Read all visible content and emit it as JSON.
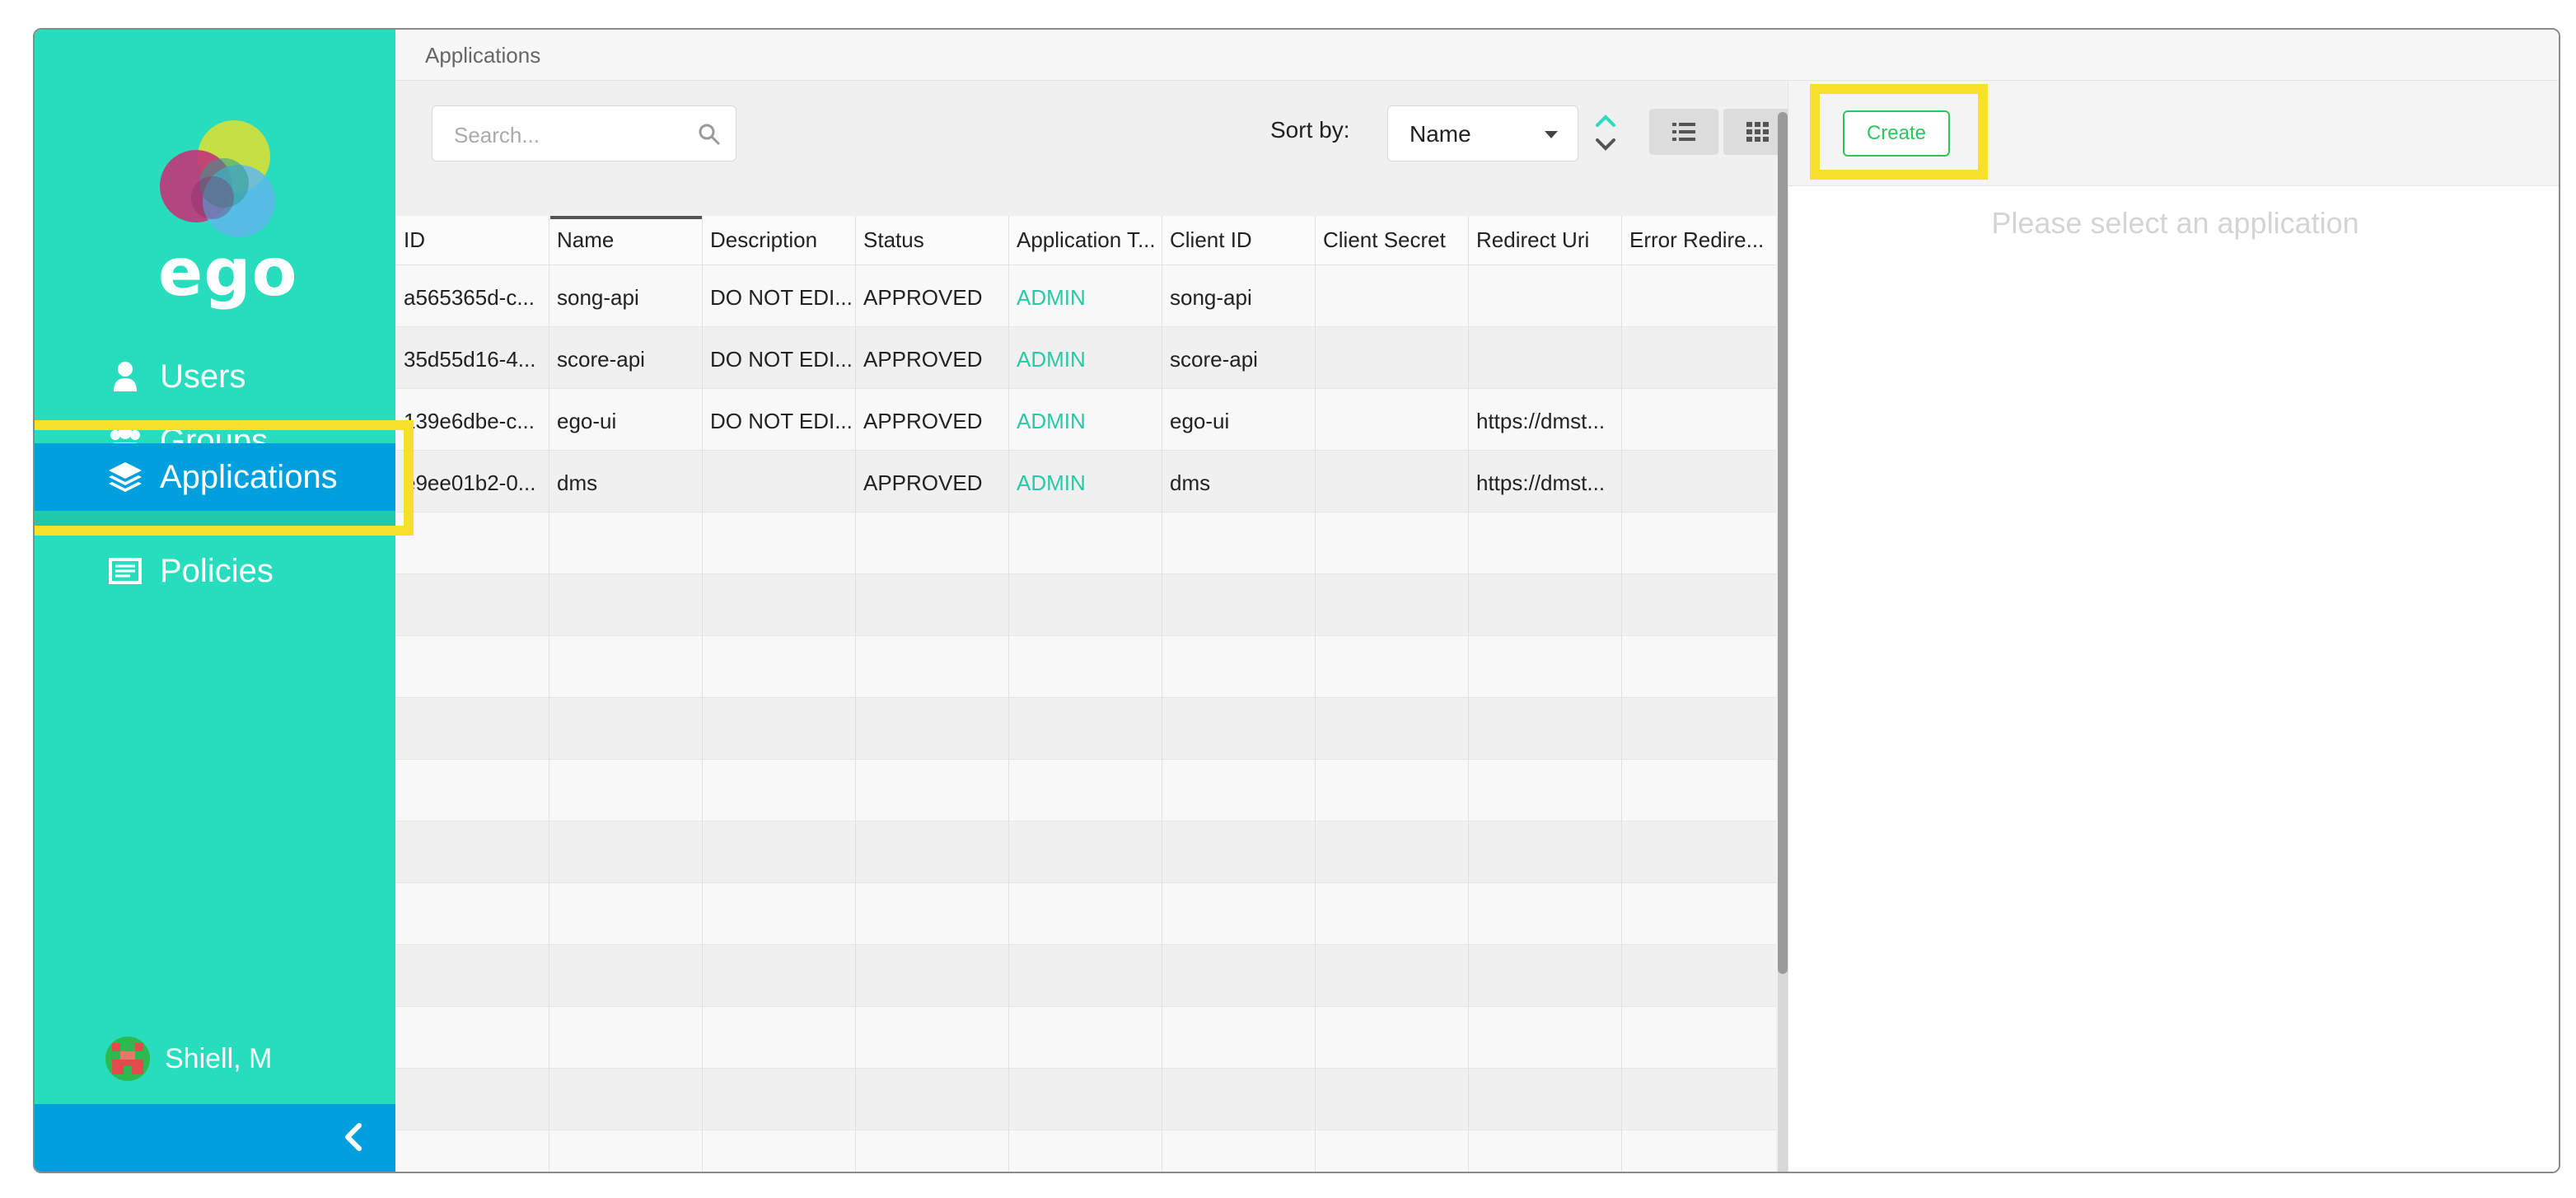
{
  "sidebar": {
    "logo_text": "ego",
    "items": [
      {
        "label": "Users",
        "icon": "user-icon"
      },
      {
        "label": "Groups",
        "icon": "groups-icon"
      },
      {
        "label": "Applications",
        "icon": "layers-icon",
        "active": true
      },
      {
        "label": "Policies",
        "icon": "policies-icon"
      }
    ],
    "user_name": "Shiell, M",
    "collapse_icon": "chevron-left-icon"
  },
  "topbar": {
    "breadcrumb": "Applications"
  },
  "toolbar": {
    "search_placeholder": "Search...",
    "sort_label": "Sort by:",
    "sort_value": "Name"
  },
  "table": {
    "columns": [
      "ID",
      "Name",
      "Description",
      "Status",
      "Application T...",
      "Client ID",
      "Client Secret",
      "Redirect Uri",
      "Error Redire..."
    ],
    "rows": [
      [
        "a565365d-c...",
        "song-api",
        "DO NOT EDI...",
        "APPROVED",
        "ADMIN",
        "song-api",
        "",
        "",
        ""
      ],
      [
        "35d55d16-4...",
        "score-api",
        "DO NOT EDI...",
        "APPROVED",
        "ADMIN",
        "score-api",
        "",
        "",
        ""
      ],
      [
        "139e6dbe-c...",
        "ego-ui",
        "DO NOT EDI...",
        "APPROVED",
        "ADMIN",
        "ego-ui",
        "",
        "https://dmst...",
        ""
      ],
      [
        "e9ee01b2-0...",
        "dms",
        "",
        "APPROVED",
        "ADMIN",
        "dms",
        "",
        "https://dmst...",
        ""
      ]
    ]
  },
  "detail": {
    "create_label": "Create",
    "empty_message": "Please select an application"
  },
  "colors": {
    "sidebar": "#28ddbd",
    "active": "#009fdd",
    "highlight": "#f7e02a",
    "create": "#2ec55c"
  }
}
